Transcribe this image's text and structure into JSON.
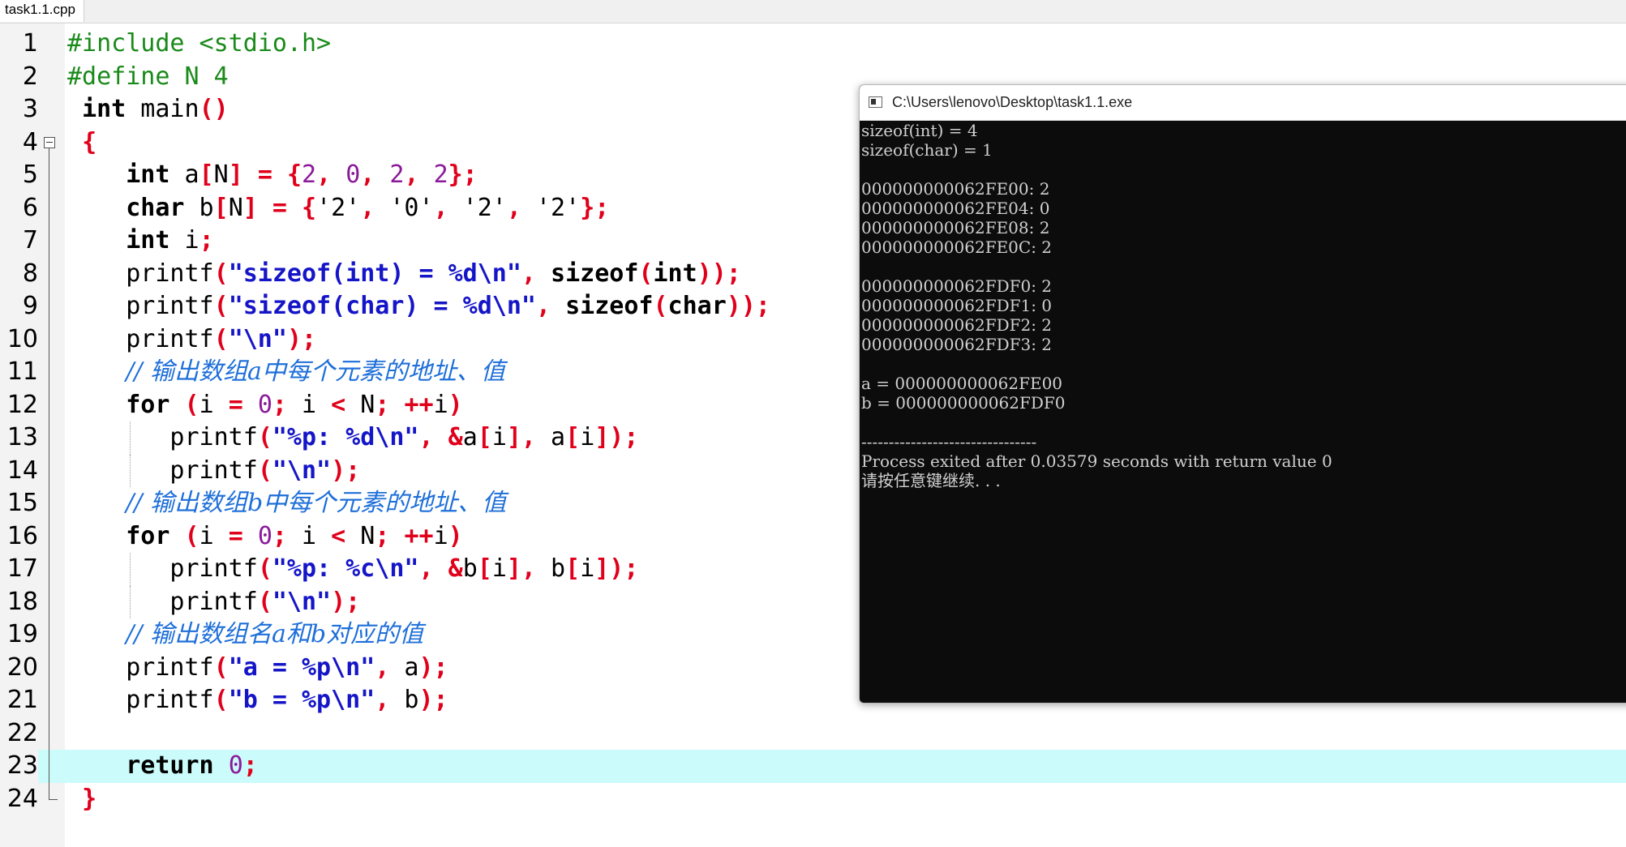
{
  "tab": {
    "title": "task1.1.cpp"
  },
  "editor": {
    "current_line": 23,
    "lines": [
      {
        "n": "1",
        "tokens": [
          [
            "pp",
            "#include <stdio.h>"
          ]
        ]
      },
      {
        "n": "2",
        "tokens": [
          [
            "pp",
            "#define N 4"
          ]
        ]
      },
      {
        "n": "3",
        "tokens": [
          [
            "id",
            " "
          ],
          [
            "kw",
            "int"
          ],
          [
            "id",
            " main"
          ],
          [
            "op",
            "()"
          ]
        ]
      },
      {
        "n": "4",
        "tokens": [
          [
            "id",
            " "
          ],
          [
            "op",
            "{"
          ]
        ]
      },
      {
        "n": "5",
        "tokens": [
          [
            "id",
            "    "
          ],
          [
            "kw",
            "int"
          ],
          [
            "id",
            " a"
          ],
          [
            "op",
            "["
          ],
          [
            "id",
            "N"
          ],
          [
            "op",
            "]"
          ],
          [
            "id",
            " "
          ],
          [
            "op",
            "="
          ],
          [
            "id",
            " "
          ],
          [
            "op",
            "{"
          ],
          [
            "num",
            "2"
          ],
          [
            "op",
            ","
          ],
          [
            "id",
            " "
          ],
          [
            "num",
            "0"
          ],
          [
            "op",
            ","
          ],
          [
            "id",
            " "
          ],
          [
            "num",
            "2"
          ],
          [
            "op",
            ","
          ],
          [
            "id",
            " "
          ],
          [
            "num",
            "2"
          ],
          [
            "op",
            "};"
          ]
        ]
      },
      {
        "n": "6",
        "tokens": [
          [
            "id",
            "    "
          ],
          [
            "kw",
            "char"
          ],
          [
            "id",
            " b"
          ],
          [
            "op",
            "["
          ],
          [
            "id",
            "N"
          ],
          [
            "op",
            "]"
          ],
          [
            "id",
            " "
          ],
          [
            "op",
            "="
          ],
          [
            "id",
            " "
          ],
          [
            "op",
            "{"
          ],
          [
            "id",
            "'2'"
          ],
          [
            "op",
            ","
          ],
          [
            "id",
            " '0'"
          ],
          [
            "op",
            ","
          ],
          [
            "id",
            " '2'"
          ],
          [
            "op",
            ","
          ],
          [
            "id",
            " '2'"
          ],
          [
            "op",
            "};"
          ]
        ]
      },
      {
        "n": "7",
        "tokens": [
          [
            "id",
            "    "
          ],
          [
            "kw",
            "int"
          ],
          [
            "id",
            " i"
          ],
          [
            "op",
            ";"
          ]
        ]
      },
      {
        "n": "8",
        "tokens": [
          [
            "id",
            "    printf"
          ],
          [
            "op",
            "("
          ],
          [
            "str",
            "\"sizeof(int) = %d\\n\""
          ],
          [
            "op",
            ","
          ],
          [
            "id",
            " "
          ],
          [
            "kw",
            "sizeof"
          ],
          [
            "op",
            "("
          ],
          [
            "kw",
            "int"
          ],
          [
            "op",
            "));"
          ]
        ]
      },
      {
        "n": "9",
        "tokens": [
          [
            "id",
            "    printf"
          ],
          [
            "op",
            "("
          ],
          [
            "str",
            "\"sizeof(char) = %d\\n\""
          ],
          [
            "op",
            ","
          ],
          [
            "id",
            " "
          ],
          [
            "kw",
            "sizeof"
          ],
          [
            "op",
            "("
          ],
          [
            "kw",
            "char"
          ],
          [
            "op",
            "));"
          ]
        ]
      },
      {
        "n": "10",
        "tokens": [
          [
            "id",
            "    printf"
          ],
          [
            "op",
            "("
          ],
          [
            "str",
            "\"\\n\""
          ],
          [
            "op",
            ");"
          ]
        ]
      },
      {
        "n": "11",
        "tokens": [
          [
            "id",
            "    "
          ],
          [
            "cm",
            "// 输出数组a中每个元素的地址、值"
          ]
        ]
      },
      {
        "n": "12",
        "tokens": [
          [
            "id",
            "    "
          ],
          [
            "kw",
            "for"
          ],
          [
            "id",
            " "
          ],
          [
            "op",
            "("
          ],
          [
            "id",
            "i "
          ],
          [
            "op",
            "="
          ],
          [
            "id",
            " "
          ],
          [
            "num",
            "0"
          ],
          [
            "op",
            ";"
          ],
          [
            "id",
            " i "
          ],
          [
            "op",
            "<"
          ],
          [
            "id",
            " N"
          ],
          [
            "op",
            ";"
          ],
          [
            "id",
            " "
          ],
          [
            "op",
            "++"
          ],
          [
            "id",
            "i"
          ],
          [
            "op",
            ")"
          ]
        ]
      },
      {
        "n": "13",
        "tokens": [
          [
            "id",
            "       printf"
          ],
          [
            "op",
            "("
          ],
          [
            "str",
            "\"%p: %d\\n\""
          ],
          [
            "op",
            ","
          ],
          [
            "id",
            " "
          ],
          [
            "op",
            "&"
          ],
          [
            "id",
            "a"
          ],
          [
            "op",
            "["
          ],
          [
            "id",
            "i"
          ],
          [
            "op",
            "],"
          ],
          [
            "id",
            " a"
          ],
          [
            "op",
            "["
          ],
          [
            "id",
            "i"
          ],
          [
            "op",
            "]);"
          ]
        ]
      },
      {
        "n": "14",
        "tokens": [
          [
            "id",
            "       printf"
          ],
          [
            "op",
            "("
          ],
          [
            "str",
            "\"\\n\""
          ],
          [
            "op",
            ");"
          ]
        ]
      },
      {
        "n": "15",
        "tokens": [
          [
            "id",
            "    "
          ],
          [
            "cm",
            "// 输出数组b中每个元素的地址、值"
          ]
        ]
      },
      {
        "n": "16",
        "tokens": [
          [
            "id",
            "    "
          ],
          [
            "kw",
            "for"
          ],
          [
            "id",
            " "
          ],
          [
            "op",
            "("
          ],
          [
            "id",
            "i "
          ],
          [
            "op",
            "="
          ],
          [
            "id",
            " "
          ],
          [
            "num",
            "0"
          ],
          [
            "op",
            ";"
          ],
          [
            "id",
            " i "
          ],
          [
            "op",
            "<"
          ],
          [
            "id",
            " N"
          ],
          [
            "op",
            ";"
          ],
          [
            "id",
            " "
          ],
          [
            "op",
            "++"
          ],
          [
            "id",
            "i"
          ],
          [
            "op",
            ")"
          ]
        ]
      },
      {
        "n": "17",
        "tokens": [
          [
            "id",
            "       printf"
          ],
          [
            "op",
            "("
          ],
          [
            "str",
            "\"%p: %c\\n\""
          ],
          [
            "op",
            ","
          ],
          [
            "id",
            " "
          ],
          [
            "op",
            "&"
          ],
          [
            "id",
            "b"
          ],
          [
            "op",
            "["
          ],
          [
            "id",
            "i"
          ],
          [
            "op",
            "],"
          ],
          [
            "id",
            " b"
          ],
          [
            "op",
            "["
          ],
          [
            "id",
            "i"
          ],
          [
            "op",
            "]);"
          ]
        ]
      },
      {
        "n": "18",
        "tokens": [
          [
            "id",
            "       printf"
          ],
          [
            "op",
            "("
          ],
          [
            "str",
            "\"\\n\""
          ],
          [
            "op",
            ");"
          ]
        ]
      },
      {
        "n": "19",
        "tokens": [
          [
            "id",
            "    "
          ],
          [
            "cm",
            "// 输出数组名a和b对应的值"
          ]
        ]
      },
      {
        "n": "20",
        "tokens": [
          [
            "id",
            "    printf"
          ],
          [
            "op",
            "("
          ],
          [
            "str",
            "\"a = %p\\n\""
          ],
          [
            "op",
            ","
          ],
          [
            "id",
            " a"
          ],
          [
            "op",
            ");"
          ]
        ]
      },
      {
        "n": "21",
        "tokens": [
          [
            "id",
            "    printf"
          ],
          [
            "op",
            "("
          ],
          [
            "str",
            "\"b = %p\\n\""
          ],
          [
            "op",
            ","
          ],
          [
            "id",
            " b"
          ],
          [
            "op",
            ");"
          ]
        ]
      },
      {
        "n": "22",
        "tokens": []
      },
      {
        "n": "23",
        "tokens": [
          [
            "id",
            "    "
          ],
          [
            "kw",
            "return"
          ],
          [
            "id",
            " "
          ],
          [
            "num",
            "0"
          ],
          [
            "op",
            ";"
          ]
        ]
      },
      {
        "n": "24",
        "tokens": [
          [
            "id",
            " "
          ],
          [
            "op",
            "}"
          ]
        ]
      }
    ]
  },
  "console": {
    "title": "C:\\Users\\lenovo\\Desktop\\task1.1.exe",
    "lines": [
      "sizeof(int) = 4",
      "sizeof(char) = 1",
      "",
      "000000000062FE00: 2",
      "000000000062FE04: 0",
      "000000000062FE08: 2",
      "000000000062FE0C: 2",
      "",
      "000000000062FDF0: 2",
      "000000000062FDF1: 0",
      "000000000062FDF2: 2",
      "000000000062FDF3: 2",
      "",
      "a = 000000000062FE00",
      "b = 000000000062FDF0",
      "",
      "--------------------------------",
      "Process exited after 0.03579 seconds with return value 0",
      "请按任意键继续. . ."
    ]
  }
}
